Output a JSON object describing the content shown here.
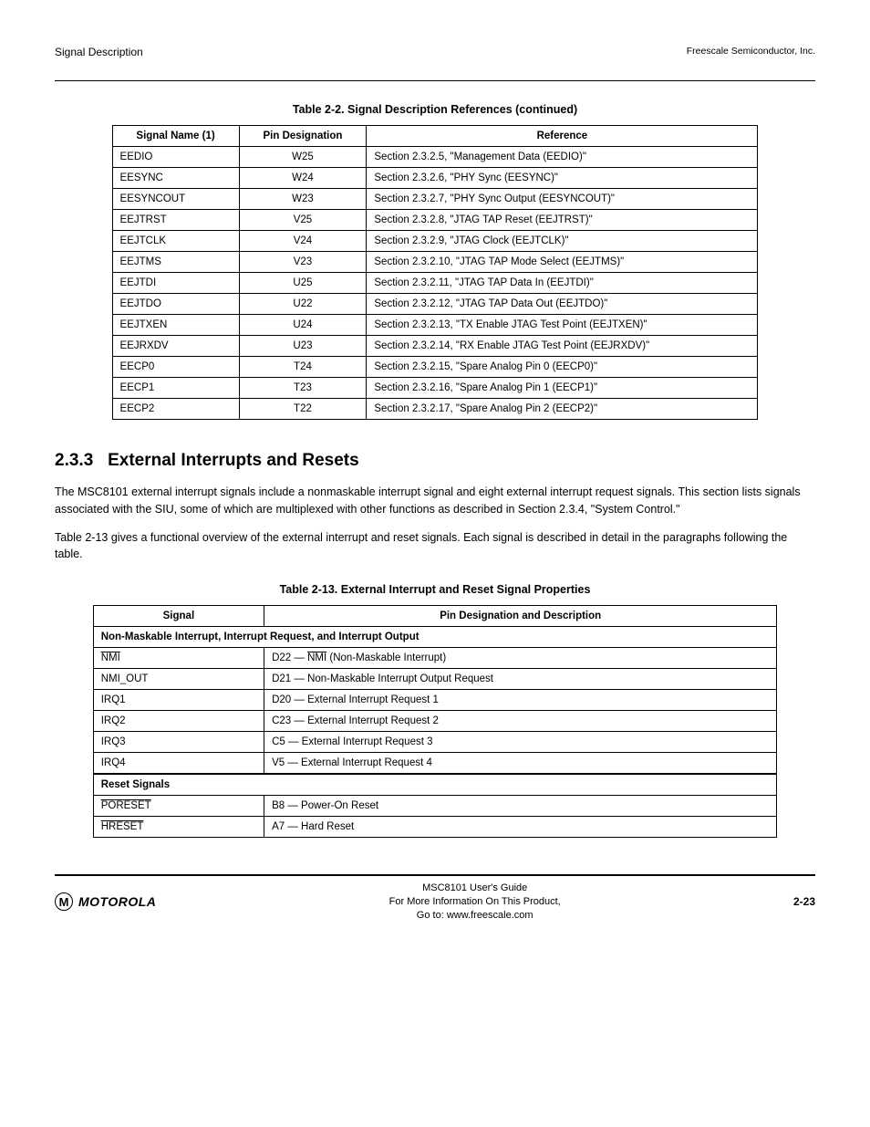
{
  "header": {
    "left": "Signal Description",
    "right": "Freescale Semiconductor, Inc."
  },
  "table1": {
    "title": "Table 2-2.  Signal Description References (continued)",
    "columns": [
      "Signal Name (1)",
      "Pin Designation",
      "Reference"
    ],
    "rows": [
      [
        "EEDIO",
        "W25",
        "Section 2.3.2.5, \"Management Data (EEDIO)\""
      ],
      [
        "EESYNC",
        "W24",
        "Section 2.3.2.6, \"PHY Sync (EESYNC)\""
      ],
      [
        "EESYNCOUT",
        "W23",
        "Section 2.3.2.7, \"PHY Sync Output (EESYNCOUT)\""
      ],
      [
        "EEJTRST",
        "V25",
        "Section 2.3.2.8, \"JTAG TAP Reset (EEJTRST)\""
      ],
      [
        "EEJTCLK",
        "V24",
        "Section 2.3.2.9, \"JTAG Clock (EEJTCLK)\""
      ],
      [
        "EEJTMS",
        "V23",
        "Section 2.3.2.10, \"JTAG TAP Mode Select (EEJTMS)\""
      ],
      [
        "EEJTDI",
        "U25",
        "Section 2.3.2.11, \"JTAG TAP Data In (EEJTDI)\""
      ],
      [
        "EEJTDO",
        "U22",
        "Section 2.3.2.12, \"JTAG TAP Data Out (EEJTDO)\""
      ],
      [
        "EEJTXEN",
        "U24",
        "Section 2.3.2.13, \"TX Enable JTAG Test Point (EEJTXEN)\""
      ],
      [
        "EEJRXDV",
        "U23",
        "Section 2.3.2.14, \"RX Enable JTAG Test Point (EEJRXDV)\""
      ],
      [
        "EECP0",
        "T24",
        "Section 2.3.2.15, \"Spare Analog Pin 0 (EECP0)\""
      ],
      [
        "EECP1",
        "T23",
        "Section 2.3.2.16, \"Spare Analog Pin 1 (EECP1)\""
      ],
      [
        "EECP2",
        "T22",
        "Section 2.3.2.17, \"Spare Analog Pin 2 (EECP2)\""
      ]
    ]
  },
  "section": {
    "number": "2.3.3",
    "title": "External Interrupts and Resets",
    "p1": "The MSC8101 external interrupt signals include a nonmaskable interrupt signal and eight external interrupt request signals. This section lists signals associated with the SIU, some of which are multiplexed with other functions as described in Section 2.3.4, \"System Control.\"",
    "p2": "Table 2-13 gives a functional overview of the external interrupt and reset signals. Each signal is described in detail in the paragraphs following the table."
  },
  "table2": {
    "title": "Table 2-13.   External Interrupt and Reset Signal Properties",
    "columns": [
      "Signal",
      "Pin Designation and Description"
    ],
    "categories": [
      {
        "name": "Non-Maskable Interrupt, Interrupt Request, and Interrupt Output",
        "rows": [
          [
            "NMI",
            "D22 — NMI (Non-Maskable Interrupt)"
          ],
          [
            "NMI_OUT",
            "D21 — Non-Maskable Interrupt Output Request"
          ],
          [
            "IRQ1",
            "D20 — External Interrupt Request 1"
          ],
          [
            "IRQ2",
            "C23 — External Interrupt Request 2"
          ],
          [
            "IRQ3",
            "C5 — External Interrupt Request 3"
          ],
          [
            "IRQ4",
            "V5 — External Interrupt Request 4"
          ]
        ]
      },
      {
        "name": "Reset Signals",
        "rows": [
          [
            "PORESET",
            "B8 — Power-On Reset"
          ],
          [
            "HRESET",
            "A7 — Hard Reset"
          ]
        ]
      }
    ]
  },
  "footer": {
    "logo_text": "MOTOROLA",
    "center_line1": "MSC8101 User's Guide",
    "center_line2": "For More Information On This Product,",
    "center_line3": "Go to: www.freescale.com",
    "right": "2-23"
  }
}
